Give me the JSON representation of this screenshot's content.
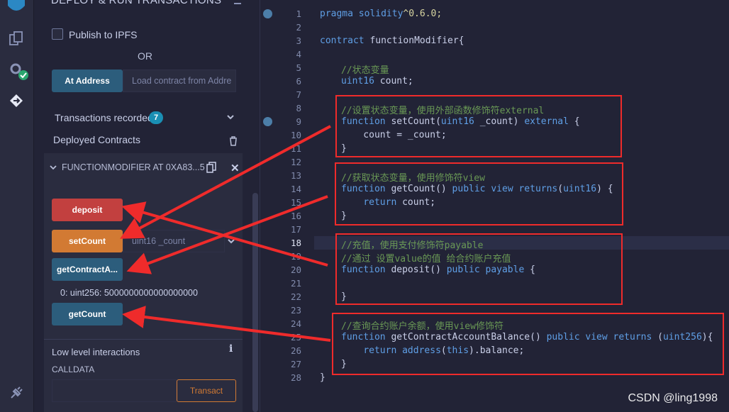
{
  "panel": {
    "title": "DEPLOY & RUN TRANSACTIONS",
    "publish_label": "Publish to IPFS",
    "or_label": "OR",
    "at_address_label": "At Address",
    "load_placeholder": "Load contract from Addre",
    "transactions_label": "Transactions recorded",
    "transactions_count": "7",
    "deployed_label": "Deployed Contracts",
    "instance_label": "FUNCTIONMODIFIER AT 0XA83...5",
    "deposit_label": "deposit",
    "setcount_label": "setCount",
    "setcount_placeholder": "uint16 _count",
    "getcontract_label": "getContractA...",
    "getcontract_result": "0: uint256: 5000000000000000000",
    "getcount_label": "getCount",
    "low_level_label": "Low level interactions",
    "calldata_label": "CALLDATA",
    "transact_label": "Transact"
  },
  "editor": {
    "current_line": "18",
    "line_numbers": [
      "1",
      "2",
      "3",
      "4",
      "5",
      "6",
      "7",
      "8",
      "9",
      "10",
      "11",
      "12",
      "13",
      "14",
      "15",
      "16",
      "17",
      "18",
      "19",
      "20",
      "21",
      "22",
      "23",
      "24",
      "25",
      "26",
      "27",
      "28"
    ],
    "lines": {
      "l1": [
        "pragma solidity",
        "^0.6.0;"
      ],
      "l3": [
        "contract ",
        "functionModifier{"
      ],
      "l5": "//状态变量",
      "l6": [
        "uint16",
        " count;"
      ],
      "l8": "//设置状态变量，使用外部函数修饰符external",
      "l9": [
        "function",
        " setCount(",
        "uint16",
        " _count) ",
        "external",
        " {"
      ],
      "l10": "    count = _count;",
      "l11": "}",
      "l13": "//获取状态变量，使用修饰符view",
      "l14": [
        "function",
        " getCount() ",
        "public view returns",
        "(",
        "uint16",
        ") {"
      ],
      "l15": [
        "    ",
        "return",
        " count;"
      ],
      "l16": "}",
      "l18": "//充值，使用支付修饰符payable",
      "l19": "//通过 设置value的值 给合约账户充值",
      "l20": [
        "function",
        " deposit() ",
        "public payable",
        " {"
      ],
      "l22": "}",
      "l24": "//查询合约账户余额，使用view修饰符",
      "l25": [
        "function",
        " getContractAccountBalance() ",
        "public view returns",
        " (",
        "uint256",
        "){"
      ],
      "l26": [
        "    ",
        "return",
        " ",
        "address",
        "(",
        "this",
        ").balance;"
      ],
      "l27": "}",
      "l28": "}"
    }
  },
  "watermark": "CSDN @ling1998",
  "colors": {
    "deposit": "#c2403f",
    "setcount": "#d27a33",
    "call": "#2c5d7c",
    "annotation": "#ef2b2b"
  }
}
